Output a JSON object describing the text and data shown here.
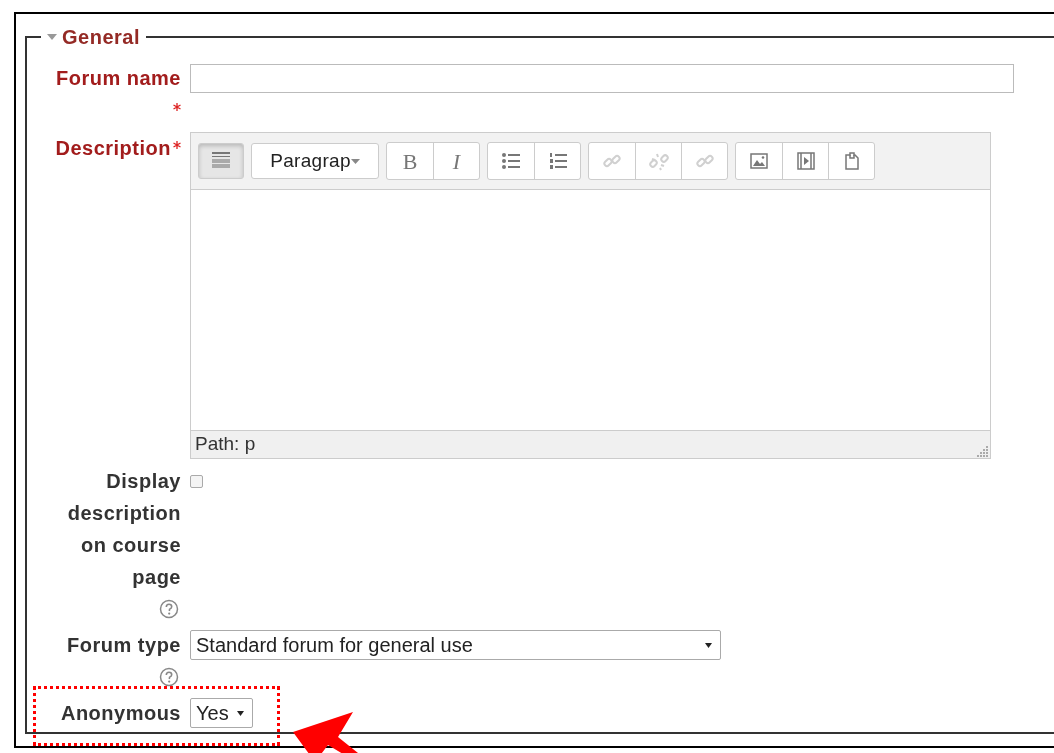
{
  "section": {
    "legend": "General",
    "expanded": true
  },
  "fields": [
    {
      "kind": "text",
      "label": "Forum name",
      "required": true
    },
    {
      "kind": "editor",
      "label": "Description",
      "required": true,
      "toolbar": [
        {
          "items": [
            {
              "kind": "toggle",
              "pressed": true,
              "disabled": false
            }
          ]
        },
        {
          "items": [
            {
              "kind": "format",
              "label": "Paragrap",
              "pressed": false,
              "disabled": false
            }
          ]
        },
        {
          "items": [
            {
              "kind": "bold",
              "label": "B",
              "pressed": false,
              "disabled": false
            },
            {
              "kind": "italic",
              "label": "I",
              "pressed": false,
              "disabled": false
            }
          ]
        },
        {
          "items": [
            {
              "kind": "bullets",
              "pressed": false,
              "disabled": false
            },
            {
              "kind": "numbers",
              "pressed": false,
              "disabled": false
            }
          ]
        },
        {
          "items": [
            {
              "kind": "link",
              "pressed": false,
              "disabled": true
            },
            {
              "kind": "unlink",
              "pressed": false,
              "disabled": true
            },
            {
              "kind": "anchor",
              "pressed": false,
              "disabled": true
            }
          ]
        },
        {
          "items": [
            {
              "kind": "image",
              "pressed": false,
              "disabled": false
            },
            {
              "kind": "media",
              "pressed": false,
              "disabled": false
            },
            {
              "kind": "paste",
              "pressed": false,
              "disabled": false
            }
          ]
        }
      ],
      "path": "Path: p"
    },
    {
      "kind": "checkbox",
      "label": "Display description on course page",
      "required": false,
      "checked": false,
      "help": true
    },
    {
      "kind": "select",
      "label": "Forum type",
      "required": false,
      "value": "Standard forum for general use",
      "help": true,
      "highlighted": false
    },
    {
      "kind": "select",
      "label": "Anonymous",
      "required": false,
      "value": "Yes",
      "help": false,
      "highlighted": true
    }
  ],
  "annotations": [
    {
      "kind": "arrow"
    }
  ]
}
